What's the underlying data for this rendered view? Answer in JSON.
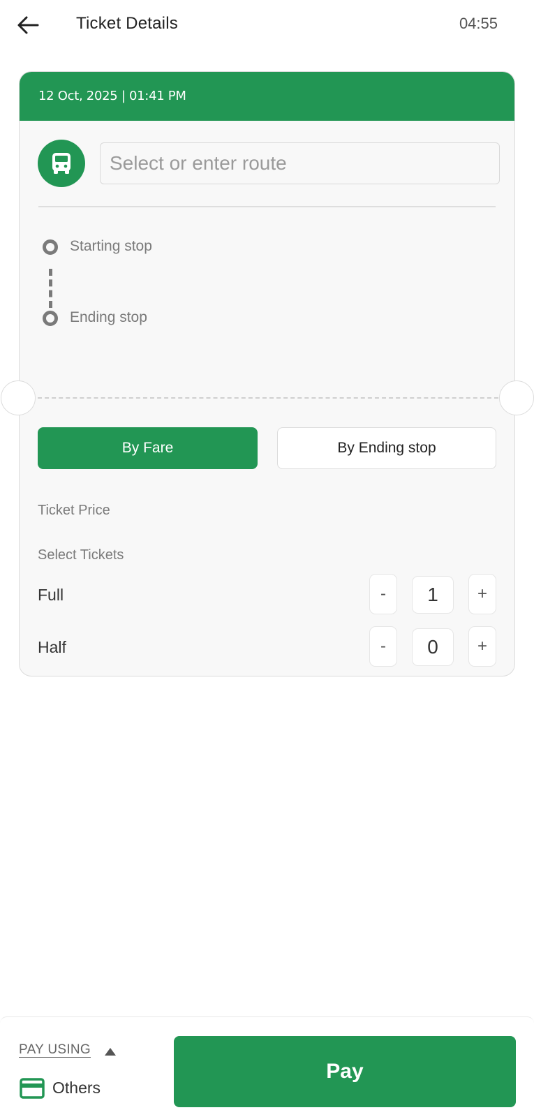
{
  "header": {
    "title": "Ticket Details",
    "timer": "04:55"
  },
  "ticket": {
    "datetime": "12 Oct, 2025 | 01:41 PM",
    "route_placeholder": "Select or enter route",
    "route_value": "",
    "starting_stop_label": "Starting stop",
    "ending_stop_label": "Ending stop",
    "tabs": [
      {
        "label": "By Fare",
        "active": true
      },
      {
        "label": "By Ending stop",
        "active": false
      }
    ],
    "ticket_price_label": "Ticket Price",
    "select_tickets_label": "Select Tickets",
    "ticket_types": [
      {
        "label": "Full",
        "quantity": "1",
        "minus": "-",
        "plus": "+"
      },
      {
        "label": "Half",
        "quantity": "0",
        "minus": "-",
        "plus": "+"
      }
    ]
  },
  "bottom": {
    "pay_using_label": "PAY USING",
    "pay_method": "Others",
    "pay_button": "Pay"
  },
  "colors": {
    "accent": "#229654",
    "muted_text": "#7a7a7a"
  },
  "icons": {
    "back": "arrow-left-icon",
    "bus": "bus-icon",
    "caret": "caret-up-icon",
    "card": "credit-card-icon"
  }
}
